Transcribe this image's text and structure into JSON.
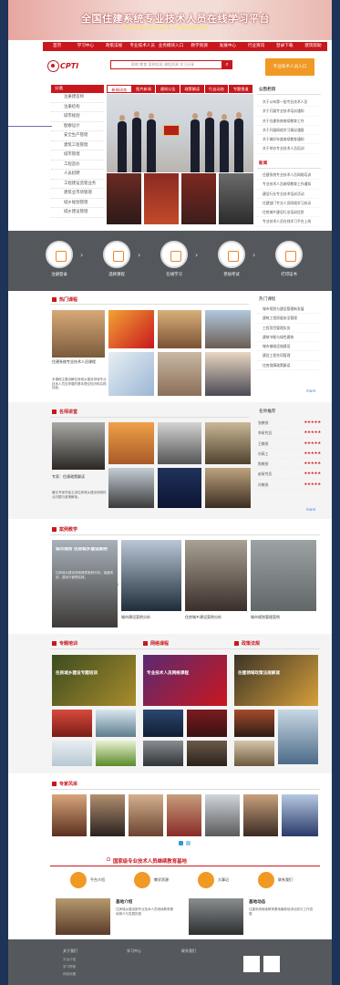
{
  "header": {
    "title": "全国住建系统专业技术人员在线学习平台",
    "subtitle": "住房城乡建设部专业技术人员继续教育基地"
  },
  "nav": [
    "首页",
    "学习中心",
    "政策法规",
    "专业技术人员",
    "业务模块入口",
    "教学资源",
    "发展中心",
    "行业资讯",
    "登录下载",
    "建筑帮助"
  ],
  "logo": {
    "text": "CPTI"
  },
  "search": {
    "placeholder": "职称  教育  案例实现  课程资源  学习分享"
  },
  "enter_btn": "专业技术人员入口",
  "category": {
    "title": "分类",
    "items": [
      "注册建造师",
      "注册结构",
      "城市规划",
      "勘察设计",
      "安全生产管理",
      "建筑工程管理",
      "城市管理",
      "工程造价",
      "人员招聘",
      "工程建设监管业务",
      "建筑业市场管理",
      "城乡规划管理",
      "城乡建设管理"
    ]
  },
  "tabs": [
    "新闻动态",
    "图片新闻",
    "通知公告",
    "政策解读",
    "行业动态",
    "专题报道"
  ],
  "notice": {
    "title": "公告栏目",
    "items": [
      "关于公布第一批专业技术人员",
      "关于开展专业技术培训通知",
      "关于住建系统继续教育工作",
      "关于开展网络学习情况通报",
      "关于做好年度继续教育通知",
      "关于举办专业技术人员培训"
    ]
  },
  "news": {
    "title": "新闻",
    "items": [
      "住建系统专业技术人员网络培训",
      "专业技术人员继续教育工作通知",
      "建设行业专业技术培训活动",
      "住建部门专业人员网络学习启动",
      "住房城乡建设行业培训信息",
      "专业技术人员在线学习平台上线"
    ]
  },
  "steps": [
    "注册登录",
    "选择课程",
    "在线学习",
    "参加考试",
    "打印证书"
  ],
  "s1": {
    "title": "热门课程",
    "side_title": "热门课程",
    "captions": [
      "住建系统专业技术人员课程"
    ],
    "desc": "本课程主要讲解住房城乡建设领域专业技术人员应掌握的基本理论知识和实践技能。",
    "list": [
      "城市规划与建设管理新发展",
      "建筑工程质量安全管理",
      "工程项目管理实务",
      "建筑节能与绿色建筑",
      "城市基础设施建设",
      "建设工程合同管理",
      "住房保障政策解读"
    ],
    "more": "more"
  },
  "s2": {
    "title": "名师讲堂",
    "side_title": "名师推荐",
    "caption": "专家：住建政策解读",
    "desc": "著名专家学者主讲住房城乡建设领域热点问题与政策解读。",
    "rank": [
      "张教授",
      "李研究员",
      "王教授",
      "刘高工",
      "陈教授",
      "赵研究员",
      "孙教授"
    ],
    "more": "more"
  },
  "s3": {
    "title": "案例教学",
    "overlay": "城市规划 住房城乡建设案例",
    "desc": "住房城乡建设领域典型案例分析，涵盖规划、建设与管理实践。",
    "caps": [
      "城市建设案例分析",
      "住房城乡建设案例分析",
      "城市规划管理案例"
    ]
  },
  "s4": {
    "cols": [
      {
        "title": "专题培训",
        "banner": "住房城乡建设专题培训"
      },
      {
        "title": "网络课程",
        "banner": "专业技术人员网络课程"
      },
      {
        "title": "政策法规",
        "banner": "住建领域政策法规解读"
      }
    ]
  },
  "s5": {
    "title": "专家风采"
  },
  "base": {
    "title": "国家级专业技术人员继续教育基地",
    "icons": [
      "平台介绍",
      "教学资源",
      "大事记",
      "联系我们"
    ],
    "news": [
      {
        "title": "基地介绍",
        "text": "住房城乡建设部专业技术人员继续教育基地简介与发展历程"
      },
      {
        "title": "基地动态",
        "text": "住建系统继续教育基地最新培训动态与工作进展"
      }
    ]
  },
  "footer": {
    "cols": [
      "关于我们",
      "学习中心",
      "联系我们"
    ],
    "links": [
      "平台介绍",
      "学习帮助",
      "网站地图"
    ]
  },
  "colors": {
    "brand": "#c9171e",
    "accent": "#f19925",
    "page_bg": "#1d3357"
  }
}
